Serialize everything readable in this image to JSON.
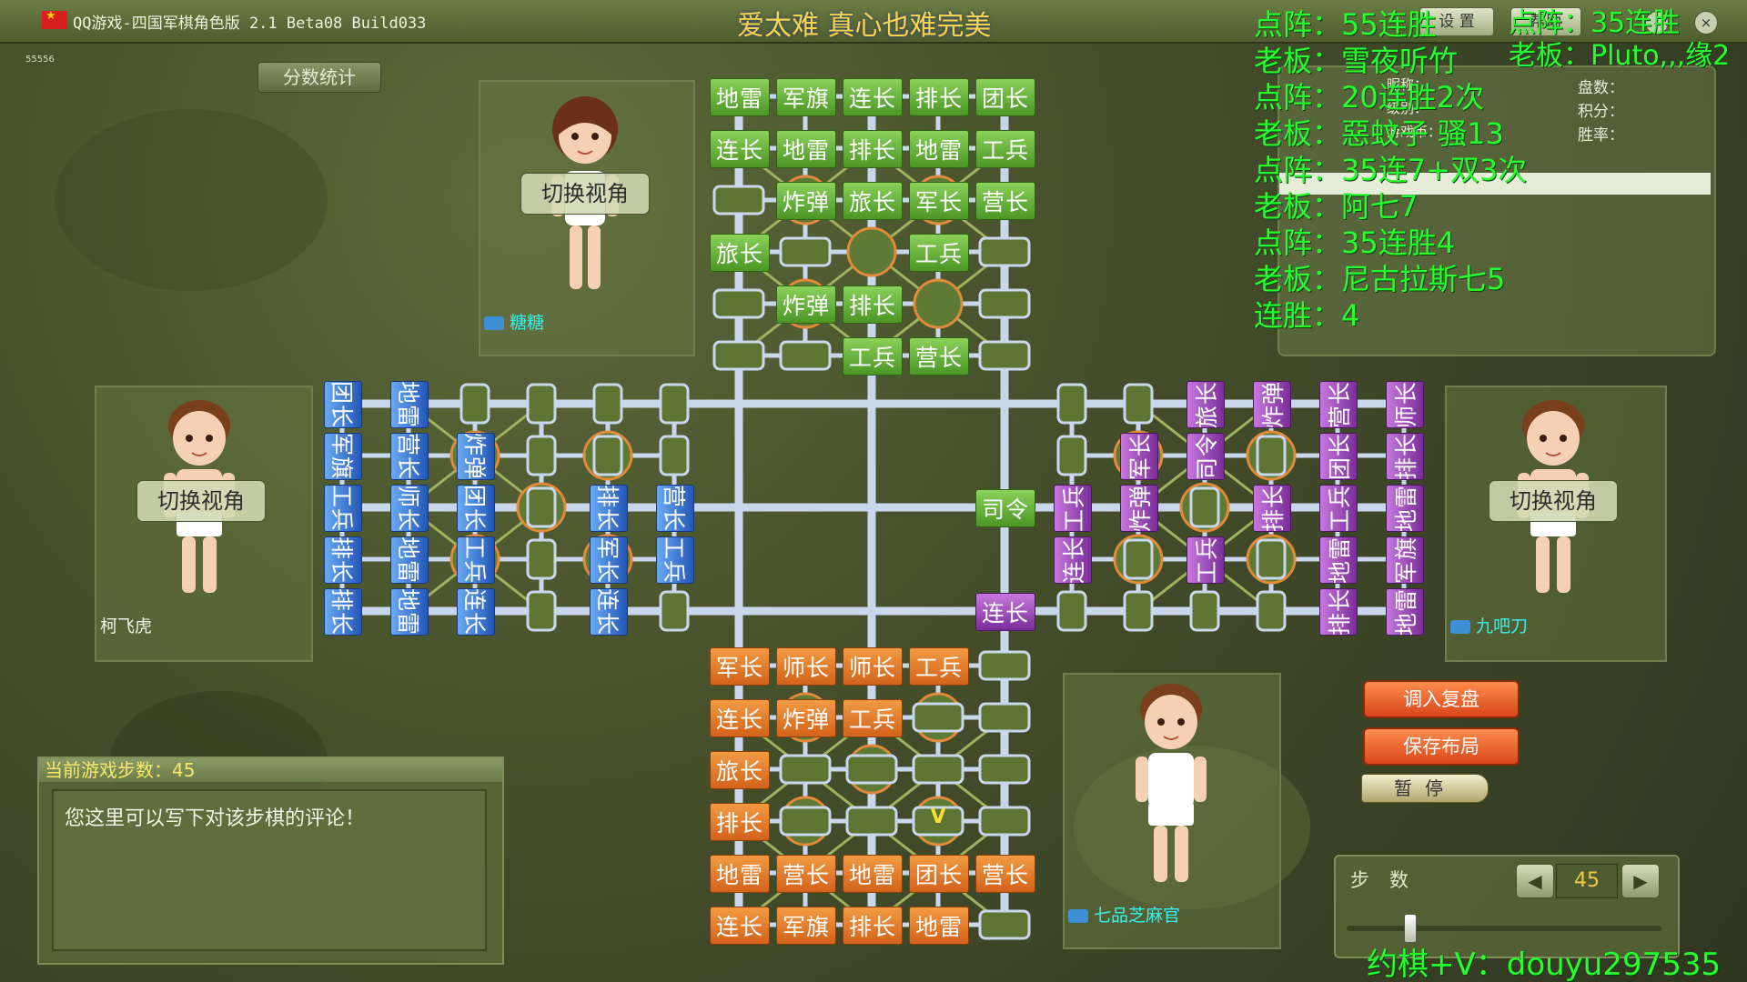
{
  "window": {
    "title": "QQ游戏-四国军棋角色版 2.1 Beta08 Build033",
    "slogan": "爱太难 真心也难完美",
    "settings_label": "设 置",
    "help_label": "帮助",
    "minimize_glyph": "–",
    "close_glyph": "×",
    "corner_label": "55556"
  },
  "score_button": "分数统计",
  "players": {
    "top": {
      "view_label": "切换视角",
      "name": "糖糖"
    },
    "left": {
      "view_label": "切换视角",
      "name": "柯飞虎"
    },
    "right": {
      "view_label": "切换视角",
      "name": "九吧刀"
    },
    "bottom": {
      "name": "七品芝麻官"
    }
  },
  "stats_panel": {
    "labels": [
      "盘数：",
      "积分：",
      "胜率："
    ],
    "left_labels": [
      "昵称：",
      "级别：",
      "游戏币："
    ]
  },
  "overlay": {
    "lines": [
      "点阵：55连胜",
      "老板：雪夜听竹",
      "点阵：20连胜2次",
      "老板：惡蚊子 骚13",
      "点阵：35连7+双3次",
      "老板：阿七7",
      "点阵：35连胜4",
      "老板：尼古拉斯七5",
      "连胜：4"
    ],
    "right_lines": [
      "点阵：35连胜",
      "老板：Pluto,,,缘2"
    ],
    "contact": "约棋+V：douyu297535"
  },
  "board": {
    "top_pieces": [
      [
        "地雷",
        "军旗",
        "连长",
        "排长",
        "团长"
      ],
      [
        "连长",
        "地雷",
        "排长",
        "地雷",
        "工兵"
      ],
      [
        "",
        "炸弹",
        "旅长",
        "军长",
        "营长"
      ],
      [
        "旅长",
        "",
        "",
        "工兵",
        ""
      ],
      [
        "",
        "炸弹",
        "排长",
        "",
        ""
      ],
      [
        "",
        "",
        "工兵",
        "营长",
        ""
      ]
    ],
    "bottom_pieces": [
      [
        "军长",
        "师长",
        "师长",
        "工兵",
        ""
      ],
      [
        "连长",
        "炸弹",
        "工兵",
        "",
        ""
      ],
      [
        "旅长",
        "",
        "",
        "",
        ""
      ],
      [
        "排长",
        "",
        "",
        "",
        ""
      ],
      [
        "地雷",
        "营长",
        "地雷",
        "团长",
        "营长"
      ],
      [
        "连长",
        "军旗",
        "排长",
        "地雷",
        ""
      ]
    ],
    "left_pieces": [
      [
        "团长",
        "军旗",
        "工兵",
        "排长",
        "排长"
      ],
      [
        "地雷",
        "营长",
        "师长",
        "地雷",
        "地雷"
      ],
      [
        "",
        "炸弹",
        "团长",
        "工兵",
        "连长"
      ],
      [
        "",
        "",
        "",
        "",
        ""
      ],
      [
        "",
        "",
        "排长",
        "军长",
        "连长"
      ],
      [
        "",
        "",
        "营长",
        "工兵",
        ""
      ]
    ],
    "right_pieces": [
      [
        "",
        "",
        "工兵",
        "连长",
        ""
      ],
      [
        "",
        "军长",
        "炸弹",
        "",
        ""
      ],
      [
        "旅长",
        "司令",
        "",
        "工兵",
        ""
      ],
      [
        "炸弹",
        "",
        "排长",
        "",
        ""
      ],
      [
        "营长",
        "团长",
        "工兵",
        "地雷",
        "排长"
      ],
      [
        "师长",
        "排长",
        "地雷",
        "军旗",
        "地雷"
      ]
    ],
    "center_green": "司令",
    "center_purple": "连长",
    "bottom_marker": "V",
    "colors": {
      "green": "#5aa832",
      "orange": "#e47a2c",
      "blue": "#3a78d6",
      "purple": "#9b42b8",
      "rail": "#c9d7ec"
    }
  },
  "comment": {
    "header": "当前游戏步数：45",
    "placeholder": "您这里可以写下对该步棋的评论！"
  },
  "controls": {
    "load_replay": "调入复盘",
    "save_layout": "保存布局",
    "pause": "暂停",
    "steps_label": "步数",
    "prev_glyph": "◀",
    "next_glyph": "▶",
    "step_value": "45",
    "slider_fraction": 0.2
  }
}
